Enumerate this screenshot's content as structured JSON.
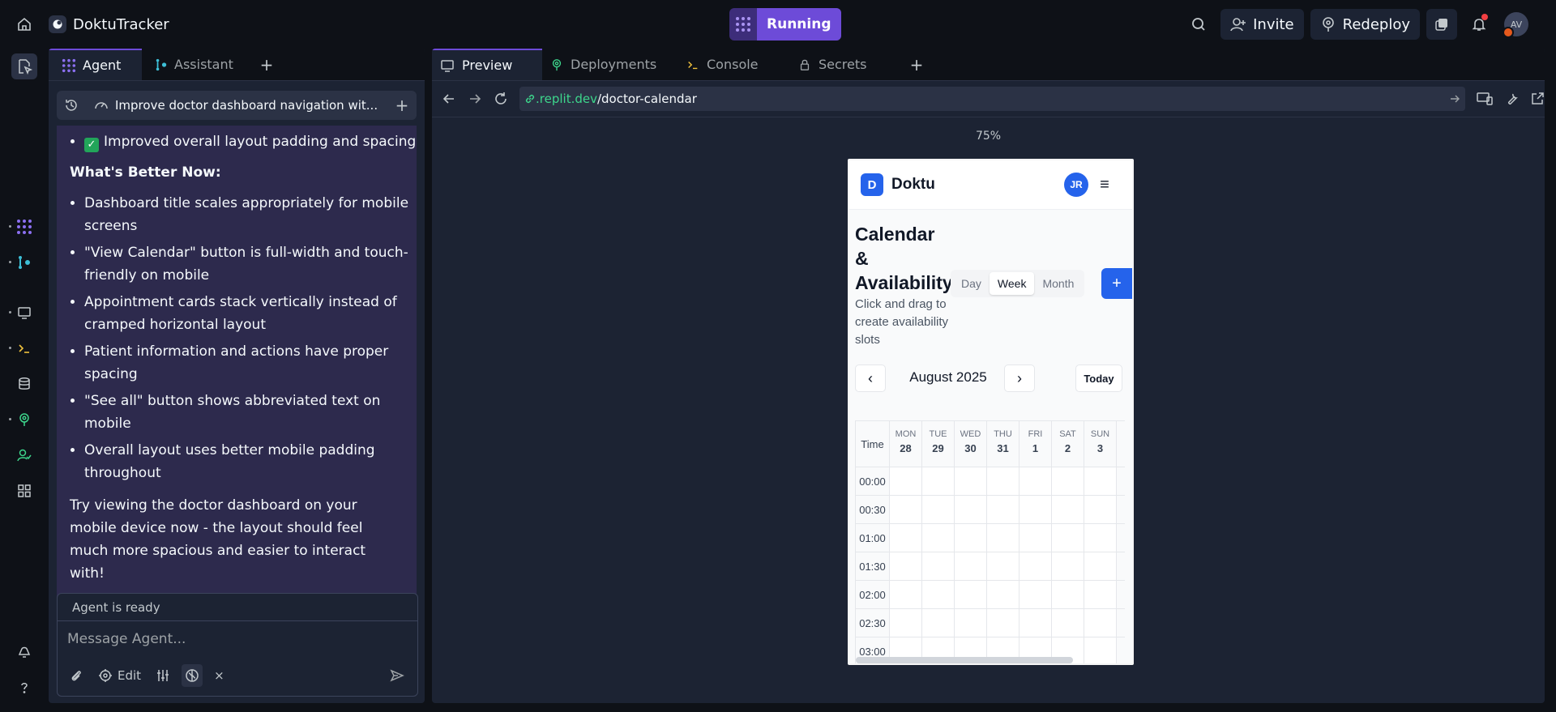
{
  "app": {
    "title": "DoktuTracker"
  },
  "status": {
    "label": "Running"
  },
  "topbar": {
    "invite_label": "Invite",
    "redeploy_label": "Redeploy",
    "avatar_initials": "AV"
  },
  "left_tabs": [
    {
      "label": "Agent"
    },
    {
      "label": "Assistant"
    }
  ],
  "thread": {
    "title": "Improve doctor dashboard navigation wit..."
  },
  "chat": {
    "first_item": "Improved overall layout padding and spacing",
    "heading": "What's Better Now:",
    "items": [
      "Dashboard title scales appropriately for mobile screens",
      "\"View Calendar\" button is full-width and touch-friendly on mobile",
      "Appointment cards stack vertically instead of cramped horizontal layout",
      "Patient information and actions have proper spacing",
      "\"See all\" button shows abbreviated text on mobile",
      "Overall layout uses better mobile padding throughout"
    ],
    "closing": "Try viewing the doctor dashboard on your mobile device now - the layout should feel much more spacious and easier to interact with!"
  },
  "agent": {
    "status": "Agent is ready",
    "placeholder": "Message Agent...",
    "edit_label": "Edit"
  },
  "right_tabs": [
    {
      "label": "Preview"
    },
    {
      "label": "Deployments"
    },
    {
      "label": "Console"
    },
    {
      "label": "Secrets"
    }
  ],
  "url": {
    "domain": ".replit.dev",
    "path": "/doctor-calendar"
  },
  "zoom": "75%",
  "preview": {
    "brand_letter": "D",
    "brand": "Doktu",
    "user_initials": "JR",
    "title": "Calendar & Availability",
    "subtitle": "Click and drag to create availability slots",
    "views": [
      {
        "label": "Day"
      },
      {
        "label": "Week"
      },
      {
        "label": "Month"
      }
    ],
    "add_label": "+",
    "month": "August 2025",
    "today_label": "Today",
    "time_header": "Time",
    "days": [
      {
        "name": "MON",
        "num": "28"
      },
      {
        "name": "TUE",
        "num": "29"
      },
      {
        "name": "WED",
        "num": "30"
      },
      {
        "name": "THU",
        "num": "31"
      },
      {
        "name": "FRI",
        "num": "1"
      },
      {
        "name": "SAT",
        "num": "2"
      },
      {
        "name": "SUN",
        "num": "3"
      }
    ],
    "times": [
      "00:00",
      "00:30",
      "01:00",
      "01:30",
      "02:00",
      "02:30",
      "03:00"
    ]
  }
}
